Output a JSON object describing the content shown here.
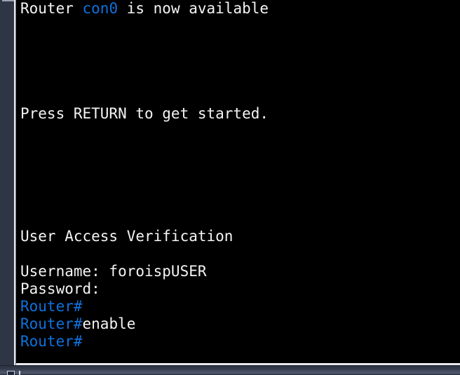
{
  "theme": {
    "terminal_background": "#000000",
    "terminal_foreground": "#f4f4f4",
    "prompt_color": "#0f72de",
    "panel_background": "#2e3646",
    "border_color": "#e8eaee"
  },
  "terminal": {
    "name": "router-console",
    "lines": [
      {
        "id": "line-1",
        "segments": [
          {
            "text": "Router ",
            "style": "white"
          },
          {
            "text": "con0",
            "style": "blue"
          },
          {
            "text": " is now available",
            "style": "white"
          }
        ]
      },
      {
        "id": "line-2",
        "segments": [
          {
            "text": "",
            "style": "white"
          }
        ]
      },
      {
        "id": "line-3",
        "segments": [
          {
            "text": "",
            "style": "white"
          }
        ]
      },
      {
        "id": "line-4",
        "segments": [
          {
            "text": "",
            "style": "white"
          }
        ]
      },
      {
        "id": "line-5",
        "segments": [
          {
            "text": "",
            "style": "white"
          }
        ]
      },
      {
        "id": "line-6",
        "segments": [
          {
            "text": "",
            "style": "white"
          }
        ]
      },
      {
        "id": "line-7",
        "segments": [
          {
            "text": "Press RETURN to get started.",
            "style": "white"
          }
        ]
      },
      {
        "id": "line-8",
        "segments": [
          {
            "text": "",
            "style": "white"
          }
        ]
      },
      {
        "id": "line-9",
        "segments": [
          {
            "text": "",
            "style": "white"
          }
        ]
      },
      {
        "id": "line-10",
        "segments": [
          {
            "text": "",
            "style": "white"
          }
        ]
      },
      {
        "id": "line-11",
        "segments": [
          {
            "text": "",
            "style": "white"
          }
        ]
      },
      {
        "id": "line-12",
        "segments": [
          {
            "text": "",
            "style": "white"
          }
        ]
      },
      {
        "id": "line-13",
        "segments": [
          {
            "text": "",
            "style": "white"
          }
        ]
      },
      {
        "id": "line-14",
        "segments": [
          {
            "text": "User Access Verification",
            "style": "white"
          }
        ]
      },
      {
        "id": "line-15",
        "segments": [
          {
            "text": "",
            "style": "white"
          }
        ]
      },
      {
        "id": "line-16",
        "segments": [
          {
            "text": "Username: foroispUSER",
            "style": "white"
          }
        ]
      },
      {
        "id": "line-17",
        "segments": [
          {
            "text": "Password:",
            "style": "white"
          }
        ]
      },
      {
        "id": "line-18",
        "segments": [
          {
            "text": "Router#",
            "style": "blue"
          }
        ]
      },
      {
        "id": "line-19",
        "segments": [
          {
            "text": "Router#",
            "style": "blue"
          },
          {
            "text": "enable",
            "style": "white"
          }
        ]
      },
      {
        "id": "line-20",
        "segments": [
          {
            "text": "Router#",
            "style": "blue"
          }
        ]
      }
    ]
  },
  "left_rail": {
    "name": "left-gutter"
  },
  "bottom_panel": {
    "name": "status-strip",
    "clipped_item_label": ""
  }
}
